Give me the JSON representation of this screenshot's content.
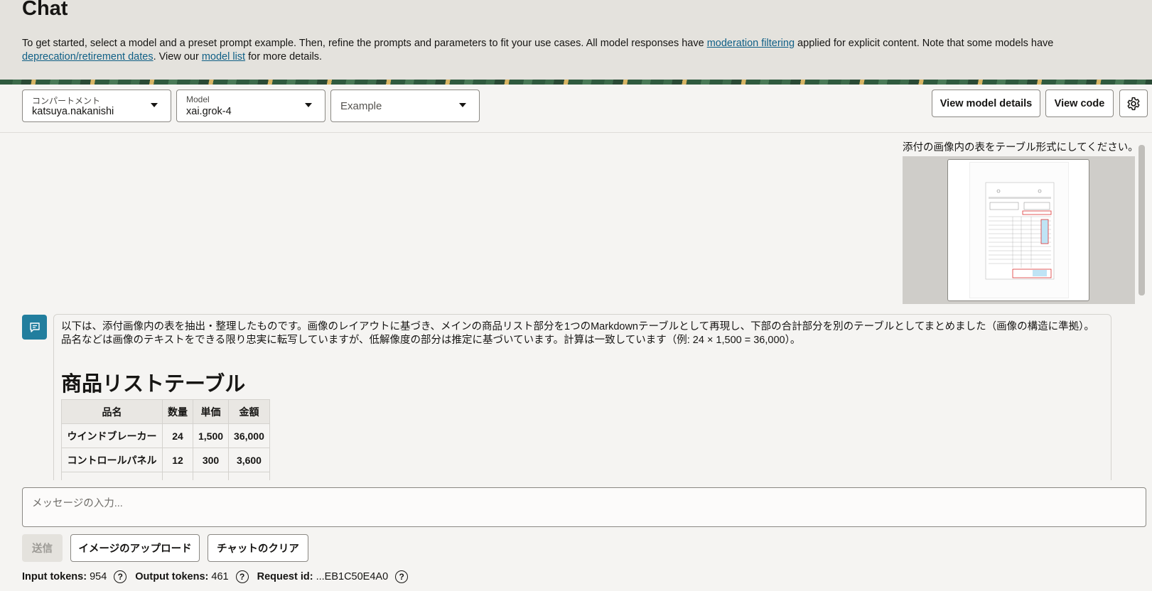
{
  "page": {
    "title": "Chat",
    "intro": {
      "part1": "To get started, select a model and a preset prompt example. Then, refine the prompts and parameters to fit your use cases. All model responses have ",
      "link1": "moderation filtering",
      "part2": " applied for explicit content. Note that some models have ",
      "link2": "deprecation/retirement dates",
      "part3": ". View our ",
      "link3": "model list",
      "part4": " for more details."
    }
  },
  "toolbar": {
    "compartment": {
      "label": "コンパートメント",
      "value": "katsuya.nakanishi"
    },
    "model": {
      "label": "Model",
      "value": "xai.grok-4"
    },
    "example": {
      "placeholder": "Example"
    },
    "view_model_details": "View model details",
    "view_code": "View code",
    "settings_icon": "gear-icon"
  },
  "chat": {
    "user_message": "添付の画像内の表をテーブル形式にしてください。",
    "attached_image": "document-thumbnail",
    "bot": {
      "icon": "chat-bubble-icon",
      "intro": "以下は、添付画像内の表を抽出・整理したものです。画像のレイアウトに基づき、メインの商品リスト部分を1つのMarkdownテーブルとして再現し、下部の合計部分を別のテーブルとしてまとめました（画像の構造に準拠）。品名などは画像のテキストをできる限り忠実に転写していますが、低解像度の部分は推定に基づいています。計算は一致しています（例: 24 × 1,500 = 36,000）。",
      "heading": "商品リストテーブル",
      "table": {
        "headers": [
          "品名",
          "数量",
          "単価",
          "金額"
        ],
        "rows": [
          [
            "ウインドブレーカー",
            "24",
            "1,500",
            "36,000"
          ],
          [
            "コントロールパネル",
            "12",
            "300",
            "3,600"
          ]
        ]
      }
    }
  },
  "composer": {
    "placeholder": "メッセージの入力...",
    "send": "送信",
    "upload_image": "イメージのアップロード",
    "clear_chat": "チャットのクリア"
  },
  "footer": {
    "input_tokens_label": "Input tokens:",
    "input_tokens": "954",
    "output_tokens_label": "Output tokens:",
    "output_tokens": "461",
    "request_id_label": "Request id:",
    "request_id": "...EB1C50E4A0"
  },
  "colors": {
    "accent": "#227e9e",
    "link": "#0f5f86",
    "header_bg": "#e4e2dd",
    "page_bg": "#f5f4f2"
  }
}
